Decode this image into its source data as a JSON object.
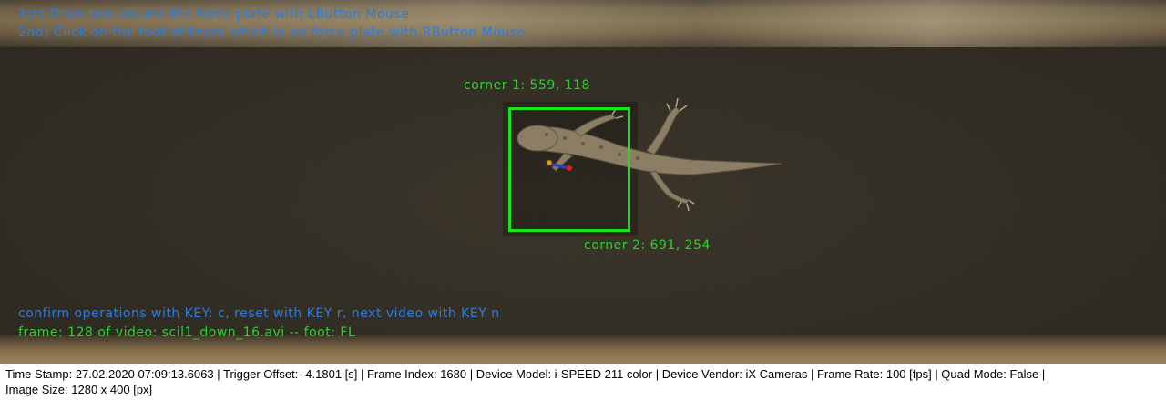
{
  "overlay": {
    "instruction_1": "1st) Draw box around the force plate with LButton Mouse",
    "instruction_2": "2nd) Click on the foot of lizard which is on force plate with RButton Mouse",
    "corner_1": "corner 1: 559, 118",
    "corner_2": "corner 2: 691, 254",
    "controls": "confirm operations with KEY: c, reset with KEY r, next video with KEY n",
    "frame_info": "frame: 128 of video: scil1_down_16.avi -- foot: FL",
    "colors": {
      "instruction_text": "#2a7de0",
      "annotation_text": "#29d429",
      "selection_box": "#19e619"
    }
  },
  "status_bar": {
    "line_1": "Time Stamp: 27.02.2020 07:09:13.6063  |  Trigger Offset: -4.1801 [s]  |  Frame Index: 1680  |  Device Model: i-SPEED 211 color  |  Device Vendor: iX Cameras  |  Frame Rate: 100 [fps]  |  Quad Mode: False  |",
    "line_2": "Image Size: 1280 x 400 [px]"
  }
}
